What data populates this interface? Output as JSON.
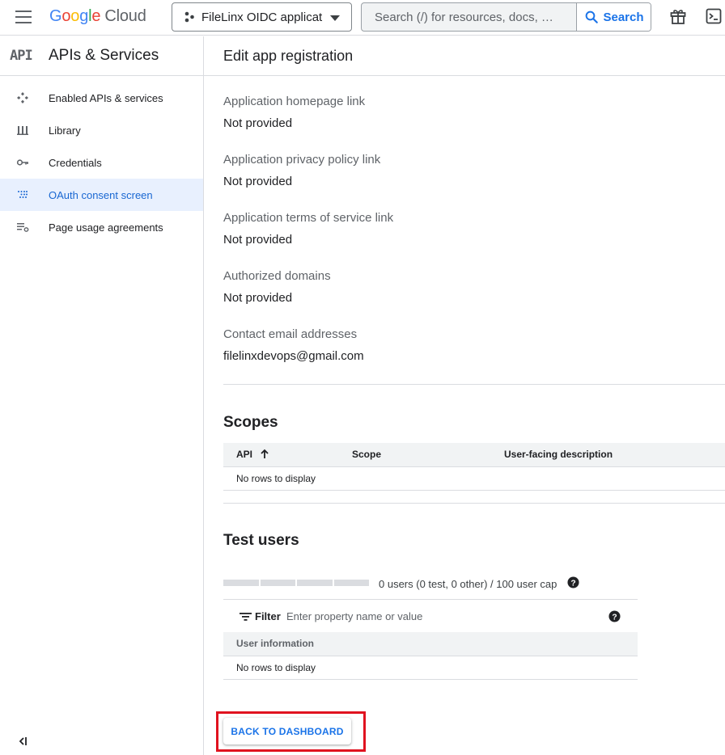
{
  "topbar": {
    "brand": {
      "g1": "G",
      "o1": "o",
      "o2": "o",
      "g2": "g",
      "l": "l",
      "e": "e",
      "cloud": "Cloud"
    },
    "project_name": "FileLinx OIDC applicatie",
    "search_placeholder": "Search (/) for resources, docs, …",
    "search_button": "Search",
    "icons": [
      "menu-icon",
      "project-icon",
      "search-icon",
      "gift-icon",
      "terminal-icon"
    ]
  },
  "sidebar": {
    "badge": "API",
    "title": "APIs & Services",
    "items": [
      {
        "label": "Enabled APIs & services",
        "icon": "enabled-apis-icon"
      },
      {
        "label": "Library",
        "icon": "library-icon"
      },
      {
        "label": "Credentials",
        "icon": "key-icon"
      },
      {
        "label": "OAuth consent screen",
        "icon": "oauth-icon",
        "active": true
      },
      {
        "label": "Page usage agreements",
        "icon": "agreements-icon"
      }
    ]
  },
  "main": {
    "title": "Edit app registration",
    "fields": [
      {
        "label": "Application homepage link",
        "value": "Not provided"
      },
      {
        "label": "Application privacy policy link",
        "value": "Not provided"
      },
      {
        "label": "Application terms of service link",
        "value": "Not provided"
      },
      {
        "label": "Authorized domains",
        "value": "Not provided"
      },
      {
        "label": "Contact email addresses",
        "value": "filelinxdevops@gmail.com"
      }
    ],
    "scopes": {
      "title": "Scopes",
      "columns": [
        "API",
        "Scope",
        "User-facing description"
      ],
      "empty": "No rows to display"
    },
    "test_users": {
      "title": "Test users",
      "cap_text": "0 users (0 test, 0 other) / 100 user cap",
      "usage_fraction": 0,
      "filter_label": "Filter",
      "filter_placeholder": "Enter property name or value",
      "column": "User information",
      "empty": "No rows to display"
    },
    "back_button": "BACK TO DASHBOARD"
  },
  "colors": {
    "accent": "#1a73e8",
    "active_bg": "#e8f0fe",
    "highlight": "#e0121f"
  }
}
